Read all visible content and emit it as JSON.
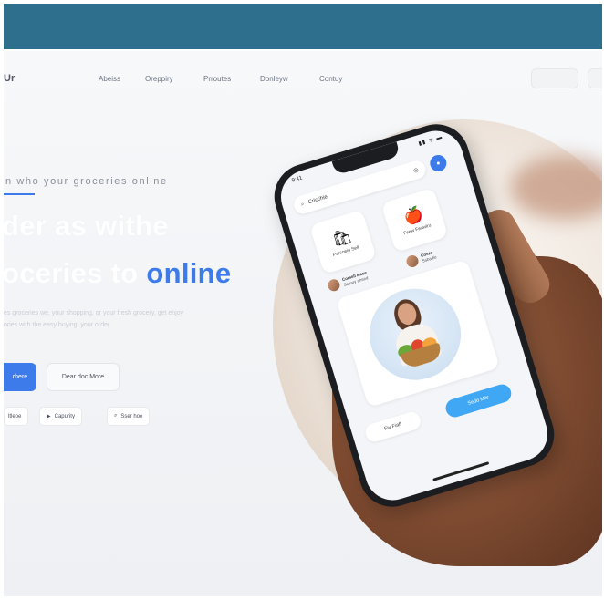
{
  "colors": {
    "top_bar": "#2e6f8e",
    "accent": "#3d7bea",
    "app_button": "#3fa7f3"
  },
  "header": {
    "logo_text": "Ur",
    "nav": [
      "Abeiss",
      "Oreppiry",
      "Prroutes",
      "Donleyw",
      "Contuy"
    ]
  },
  "hero": {
    "eyebrow": "n who your groceries online",
    "headline_line1": "der as withe",
    "headline_line2_part1": "oceries to ",
    "headline_line2_accent": "online",
    "paragraph_line1": "es groceries we, your shopping, or your fresh grocery, get enjoy",
    "paragraph_line2": "ories with the easy buying, your order",
    "primary_button": "rhere",
    "secondary_button": "Dear doc More",
    "store_buttons": [
      {
        "label": "ltleoe",
        "icon": "apple-icon"
      },
      {
        "label": "Capurity",
        "icon": "play-store-icon"
      },
      {
        "label": "Sser hoe",
        "icon": "search-icon"
      }
    ]
  },
  "phone": {
    "time": "9:41",
    "status": "▮▮ ᯤ ▬",
    "search_text": "Cricchie",
    "categories": [
      {
        "label": "Parcoeid Sell",
        "icon": "grocery-bag-icon"
      },
      {
        "label": "Fsew Feawiru",
        "icon": "fruit-icon"
      }
    ],
    "people": [
      {
        "name": "Corsell lease",
        "sub": "Sceary ahsed"
      },
      {
        "name": "Cosze",
        "sub": "Ssbadie"
      }
    ],
    "button_left": "Fiv Fiafl",
    "button_right": "Sedd Mlls"
  }
}
